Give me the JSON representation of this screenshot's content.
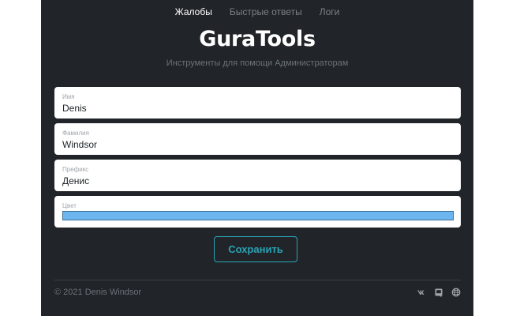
{
  "nav": {
    "items": [
      {
        "label": "Жалобы",
        "active": true
      },
      {
        "label": "Быстрые ответы",
        "active": false
      },
      {
        "label": "Логи",
        "active": false
      }
    ]
  },
  "header": {
    "title": "GuraTools",
    "subtitle": "Инструменты для помощи Администраторам"
  },
  "form": {
    "first_name": {
      "label": "Имя",
      "value": "Denis"
    },
    "last_name": {
      "label": "Фамилия",
      "value": "Windsor"
    },
    "prefix": {
      "label": "Префикс",
      "value": "Денис"
    },
    "color": {
      "label": "Цвет",
      "value": "#6cb5ef"
    },
    "save_label": "Сохранить"
  },
  "footer": {
    "copyright": "© 2021 Denis Windsor",
    "icons": [
      "vk-icon",
      "discord-icon",
      "globe-icon"
    ]
  },
  "colors": {
    "panel_bg": "#212529",
    "accent": "#2aa3b4",
    "muted_text": "#6c727a"
  }
}
